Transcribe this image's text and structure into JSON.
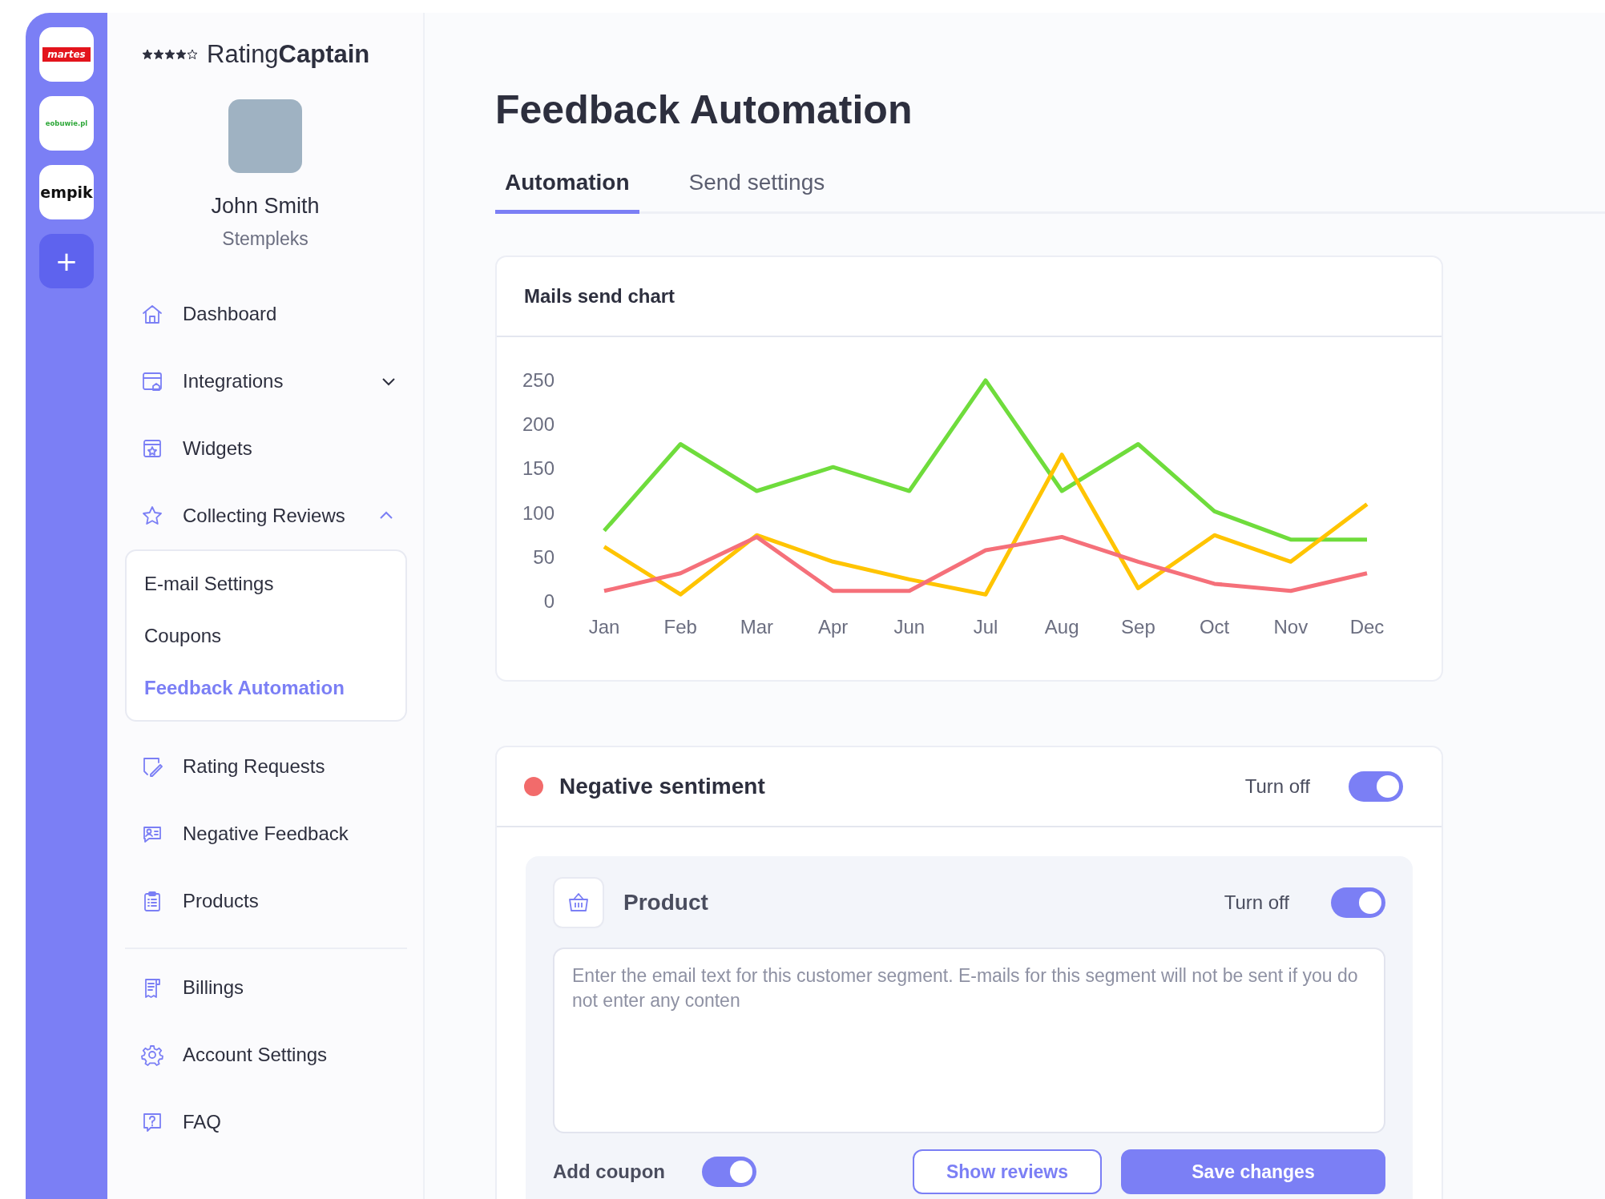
{
  "store_rail": {
    "stores": [
      {
        "label": "martes",
        "kind": "filled",
        "color": "#e3141c"
      },
      {
        "label": "eobuwie.pl",
        "kind": "text",
        "color": "#2fa83a"
      },
      {
        "label": "empik",
        "kind": "text",
        "color": "#111111"
      }
    ],
    "add_button": "+"
  },
  "sidebar": {
    "logo": "Rating**Captain**",
    "user": {
      "name": "John Smith",
      "company": "Stempleks"
    },
    "items": [
      {
        "label": "Dashboard",
        "kind": "home",
        "selected": false
      },
      {
        "label": "Integrations",
        "kind": "window",
        "selected": false,
        "expanded": false
      },
      {
        "label": "Widgets",
        "kind": "widget",
        "selected": false
      },
      {
        "label": "Collecting Reviews",
        "kind": "star",
        "selected": false,
        "expanded": true,
        "children": [
          {
            "label": "E-mail Settings",
            "selected": false
          },
          {
            "label": "Coupons",
            "selected": false
          },
          {
            "label": "Feedback Automation",
            "selected": true
          }
        ]
      },
      {
        "label": "Rating Requests",
        "kind": "pen",
        "selected": false
      },
      {
        "label": "Negative Feedback",
        "kind": "contact",
        "selected": false
      },
      {
        "label": "Products",
        "kind": "clipboard",
        "selected": false
      }
    ],
    "bottom_items": [
      {
        "label": "Billings",
        "kind": "receipt",
        "selected": false
      },
      {
        "label": "Account Settings",
        "kind": "gear",
        "selected": false
      },
      {
        "label": "FAQ",
        "kind": "question",
        "selected": false
      }
    ]
  },
  "page": {
    "title": "Feedback Automation",
    "tabs": [
      {
        "label": "Automation",
        "selected": true
      },
      {
        "label": "Send settings",
        "selected": false
      }
    ],
    "chart_card": {
      "title": "Mails send chart",
      "chart_data": {
        "type": "line",
        "categories": [
          "Jan",
          "Feb",
          "Mar",
          "Apr",
          "Jun",
          "Jul",
          "Aug",
          "Sep",
          "Oct",
          "Nov",
          "Dec"
        ],
        "ylim": [
          0,
          250
        ],
        "yticks": [
          0,
          50,
          100,
          150,
          200,
          250
        ],
        "series": [
          {
            "color": "#6fdc3c",
            "values": [
              80,
              178,
              125,
              152,
              125,
              250,
              125,
              178,
              102,
              70,
              70
            ]
          },
          {
            "color": "#ffc400",
            "values": [
              62,
              8,
              75,
              45,
              25,
              8,
              166,
              15,
              75,
              45,
              110
            ]
          },
          {
            "color": "#f5707a",
            "values": [
              12,
              32,
              73,
              12,
              12,
              58,
              73,
              45,
              20,
              12,
              32
            ]
          }
        ]
      }
    },
    "segment_card": {
      "title": "Negative sentiment",
      "color": "#f26b6b",
      "toggle_label": "Turn off",
      "on": true,
      "product": {
        "title": "Product",
        "toggle_label": "Turn off",
        "on": true,
        "message": {
          "placeholder": "Enter the email text for this customer segment. E-mails for this segment will not be sent if you do not enter any conten"
        }
      },
      "coupon": {
        "label": "Add coupon",
        "on": true
      },
      "buttons": [
        {
          "label": "Show reviews",
          "kind": "outline"
        },
        {
          "label": "Save changes",
          "kind": "primary"
        }
      ]
    }
  }
}
